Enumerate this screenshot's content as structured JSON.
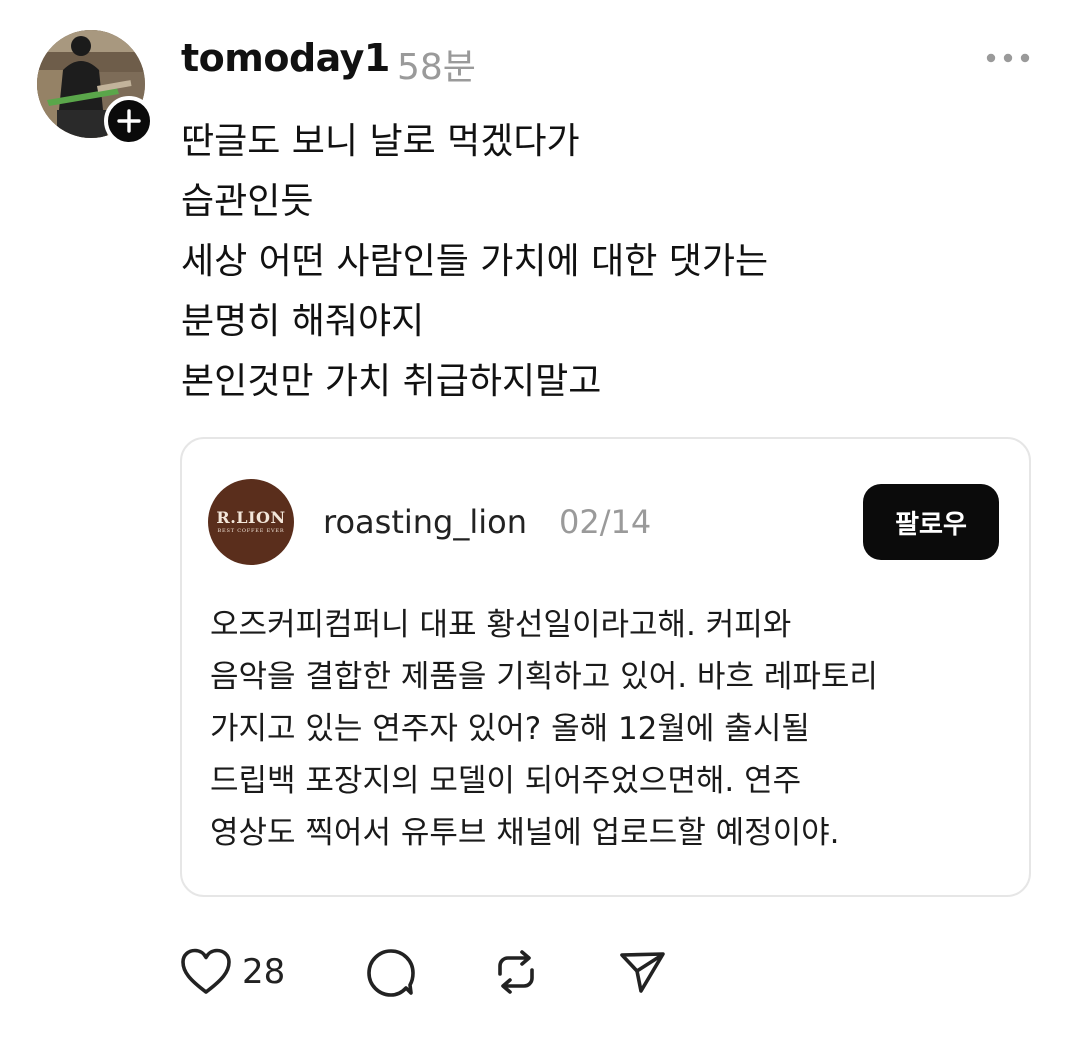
{
  "post": {
    "username": "tomoday1",
    "timestamp": "58분",
    "body_lines": [
      "딴글도 보니 날로 먹겠다가",
      "습관인듯",
      "세상 어떤 사람인들 가치에 대한 댓가는",
      "분명히 해줘야지",
      "본인것만 가치 취급하지말고"
    ]
  },
  "quote": {
    "avatar_logo": "R.LION",
    "avatar_tagline": "BEST COFFEE EVER",
    "username": "roasting_lion",
    "date": "02/14",
    "follow_label": "팔로우",
    "lines": [
      "오즈커피컴퍼니 대표 황선일이라고해. 커피와",
      "음악을 결합한 제품을 기획하고 있어. 바흐 레파토리",
      "가지고 있는 연주자 있어? 올해 12월에 출시될",
      "드립백 포장지의 모델이 되어주었으면해. 연주",
      "영상도 찍어서 유투브 채널에 업로드할 예정이야."
    ]
  },
  "actions": {
    "like_count": "28"
  },
  "icons": {
    "avatar_follow": "plus-icon",
    "more": "more-horizontal-icon",
    "like": "heart-icon",
    "comment": "comment-bubble-icon",
    "repost": "repost-icon",
    "share": "send-icon"
  },
  "colors": {
    "text": "#111111",
    "muted": "#9a9a9a",
    "button": "#0b0b0b",
    "card_border": "#e6e6e6",
    "brand_avatar": "#5a2e1c"
  }
}
